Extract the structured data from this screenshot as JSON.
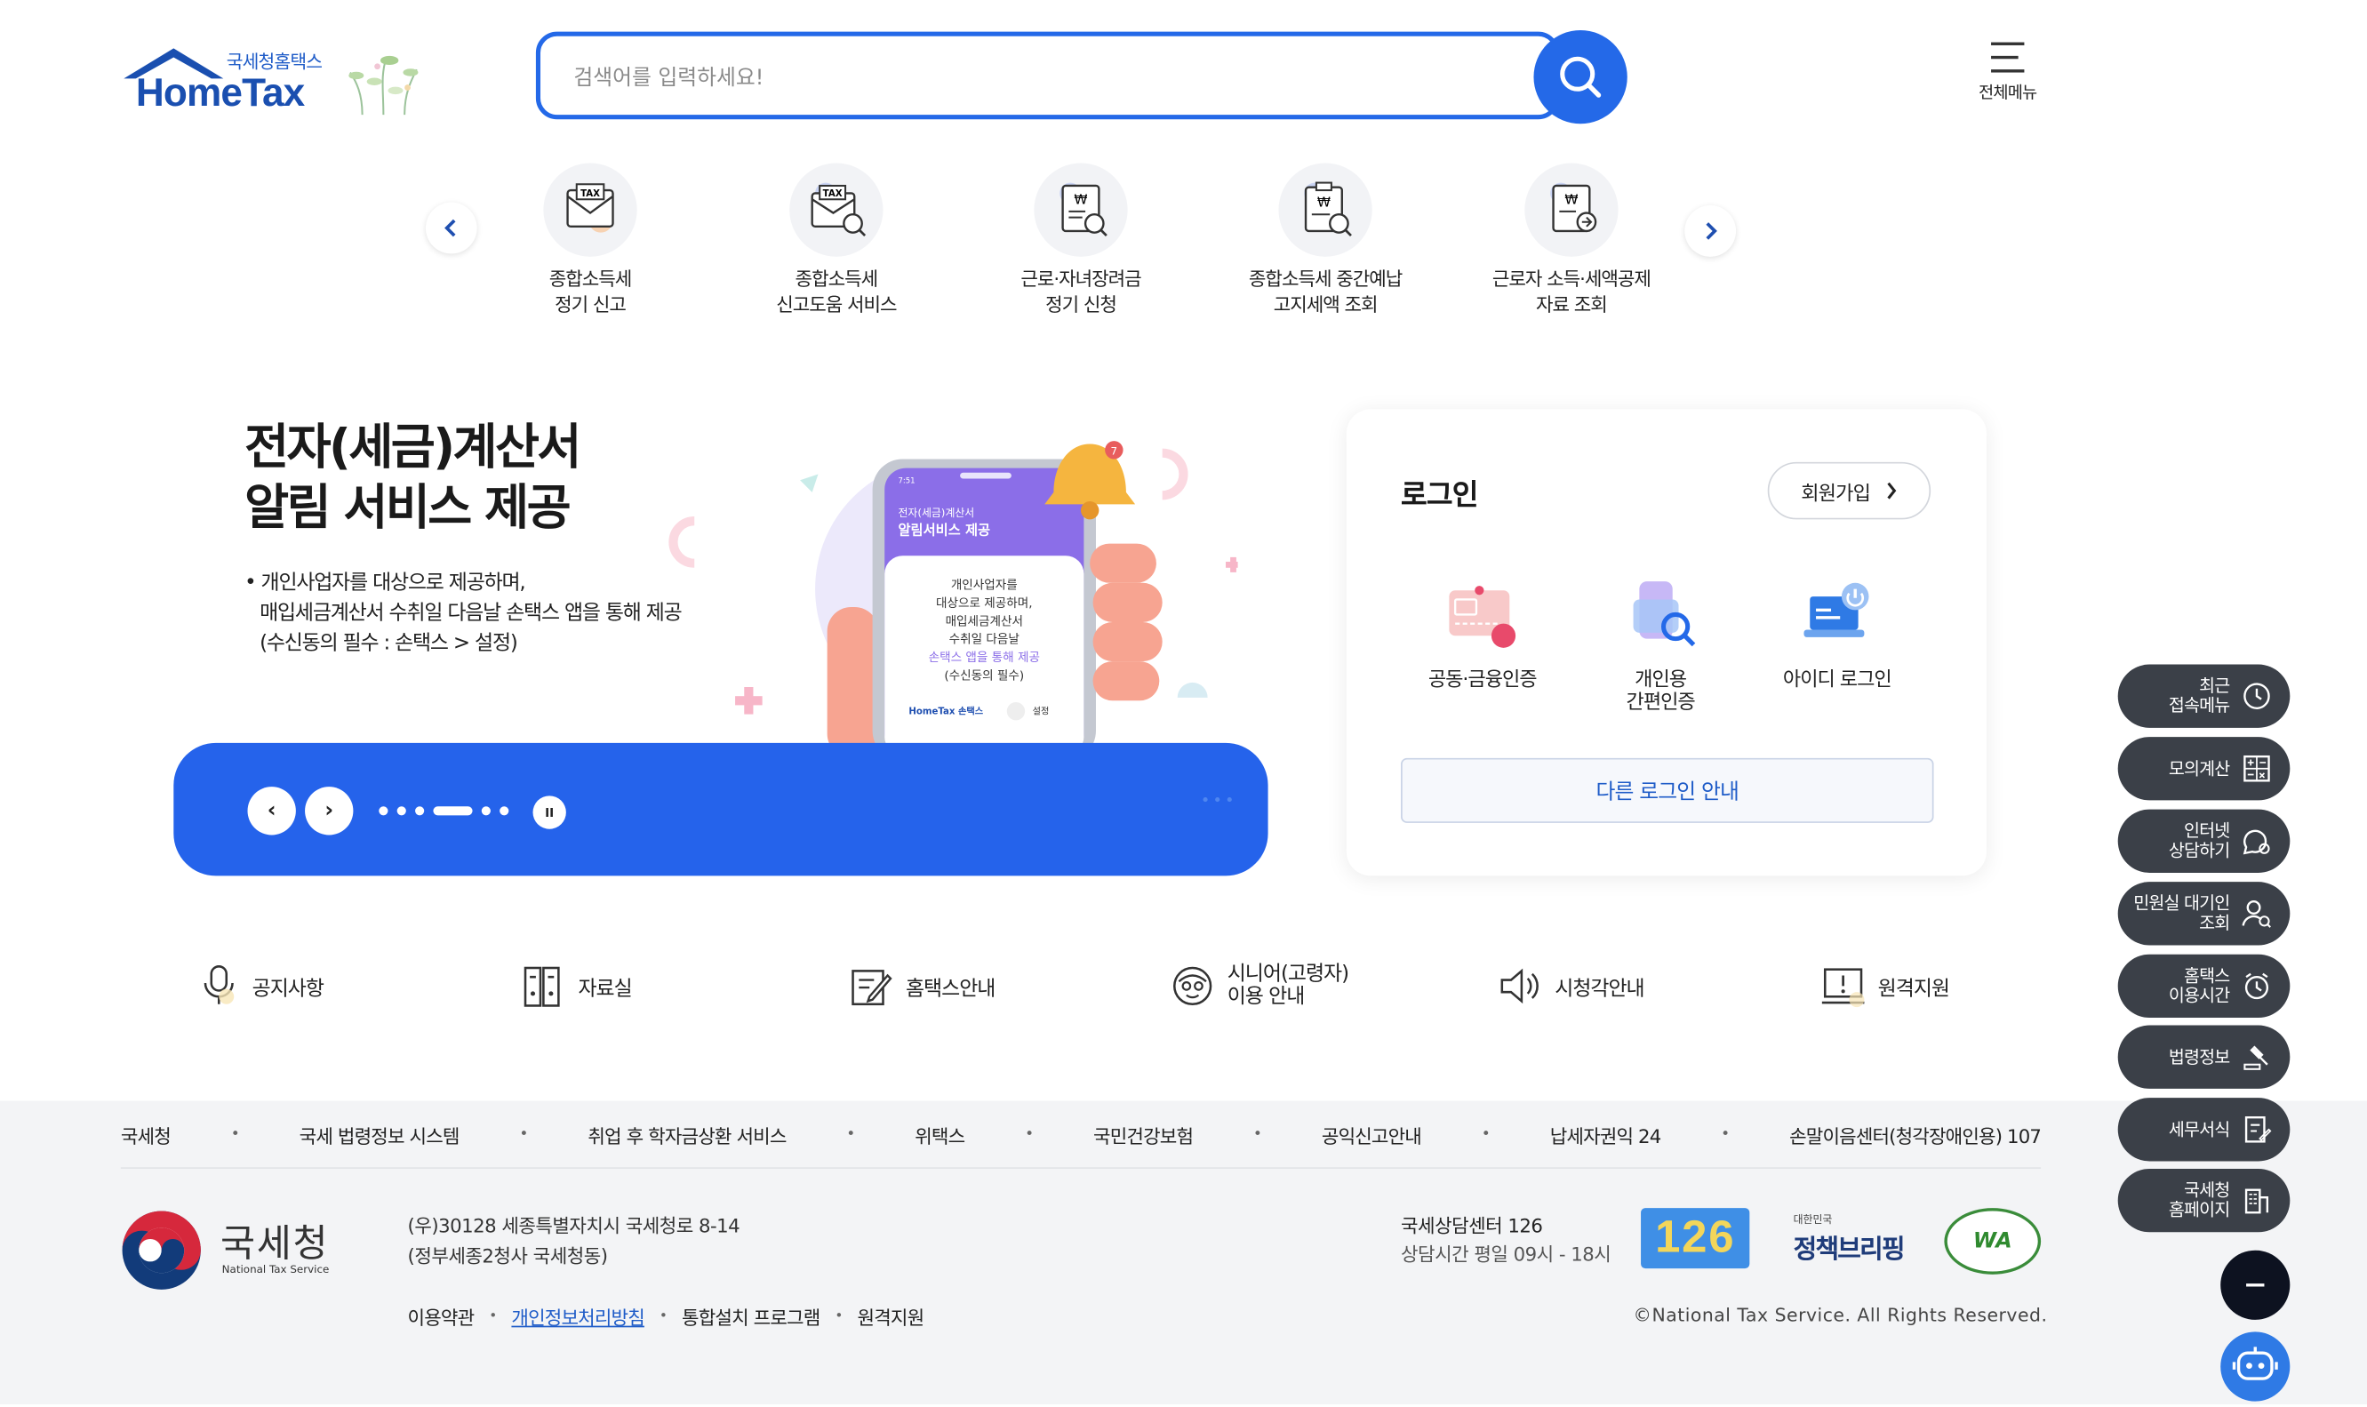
{
  "header": {
    "brand_small": "국세청홈택스",
    "brand_big": "HomeTax",
    "search_placeholder": "검색어를 입력하세요!",
    "menu_label": "전체메뉴"
  },
  "quick_services": [
    {
      "line1": "종합소득세",
      "line2": "정기 신고",
      "icon": "tax-envelope-icon"
    },
    {
      "line1": "종합소득세",
      "line2": "신고도움 서비스",
      "icon": "tax-search-envelope-icon"
    },
    {
      "line1": "근로·자녀장려금",
      "line2": "정기 신청",
      "icon": "won-document-search-icon"
    },
    {
      "line1": "종합소득세 중간예납",
      "line2": "고지세액 조회",
      "icon": "won-clipboard-search-icon"
    },
    {
      "line1": "근로자 소득·세액공제",
      "line2": "자료 조회",
      "icon": "won-document-refresh-icon"
    }
  ],
  "banner": {
    "title_line1": "전자(세금)계산서",
    "title_line2": "알림 서비스 제공",
    "desc_line1": "• 개인사업자를 대상으로 제공하며,",
    "desc_line2": "매입세금계산서 수취일 다음날 손택스 앱을 통해 제공",
    "desc_line3": "(수신동의 필수 : 손택스 > 설정)",
    "phone": {
      "time": "7:51",
      "head1": "전자(세금)계산서",
      "head2": "알림서비스 제공",
      "body1": "개인사업자를",
      "body2": "대상으로 제공하며,",
      "body3": "매입세금계산서",
      "body4": "수취일 다음날",
      "body5": "손택스 앱을 통해 제공",
      "body6": "(수신동의 필수)",
      "footer_brand": "HomeTax 손택스",
      "footer_action": "설정"
    },
    "prev_label": "‹",
    "next_label": "›",
    "pause_label": "II"
  },
  "login": {
    "title": "로그인",
    "join_label": "회원가입",
    "options": [
      {
        "line1": "공동·금융인증",
        "line2": ""
      },
      {
        "line1": "개인용",
        "line2": "간편인증"
      },
      {
        "line1": "아이디 로그인",
        "line2": ""
      }
    ],
    "other_label": "다른 로그인 안내"
  },
  "quick_links": [
    {
      "label": "공지사항"
    },
    {
      "label": "자료실"
    },
    {
      "label": "홈택스안내"
    },
    {
      "label": "시니어(고령자)\n이용 안내"
    },
    {
      "label": "시청각안내"
    },
    {
      "label": "원격지원"
    }
  ],
  "side_menu": [
    {
      "label": "최근\n접속메뉴",
      "icon": "clock-icon"
    },
    {
      "label": "모의계산",
      "icon": "calculator-icon"
    },
    {
      "label": "인터넷\n상담하기",
      "icon": "chat-icon"
    },
    {
      "label": "민원실 대기인\n조회",
      "icon": "person-search-icon"
    },
    {
      "label": "홈택스\n이용시간",
      "icon": "clock-icon"
    },
    {
      "label": "법령정보",
      "icon": "gavel-icon"
    },
    {
      "label": "세무서식",
      "icon": "form-icon"
    },
    {
      "label": "국세청\n홈페이지",
      "icon": "building-icon"
    }
  ],
  "footer": {
    "links": [
      "국세청",
      "국세 법령정보 시스템",
      "취업 후 학자금상환 서비스",
      "위택스",
      "국민건강보험",
      "공익신고안내",
      "납세자권익 24",
      "손말이음센터(청각장애인용) 107"
    ],
    "nts_name": "국세청",
    "nts_en": "National Tax Service",
    "address_line1": "(우)30128 세종특별자치시 국세청로 8-14",
    "address_line2": "(정부세종2청사 국세청동)",
    "menu": [
      "이용약관",
      "개인정보처리방침",
      "통합설치 프로그램",
      "원격지원"
    ],
    "center_title": "국세상담센터 126",
    "center_hours": "상담시간 평일 09시 - 18시",
    "badge_126": "126",
    "policy_small": "대한민국",
    "policy_big": "정책브리핑",
    "wa_label": "WA",
    "copyright": "©National Tax Service. All Rights Reserved."
  },
  "colors": {
    "primary": "#2469e8",
    "banner_blue": "#2563eb",
    "side_dark": "#3b4048",
    "footer_bg": "#f3f4f6",
    "chatbot_blue": "#2f7ae5"
  }
}
